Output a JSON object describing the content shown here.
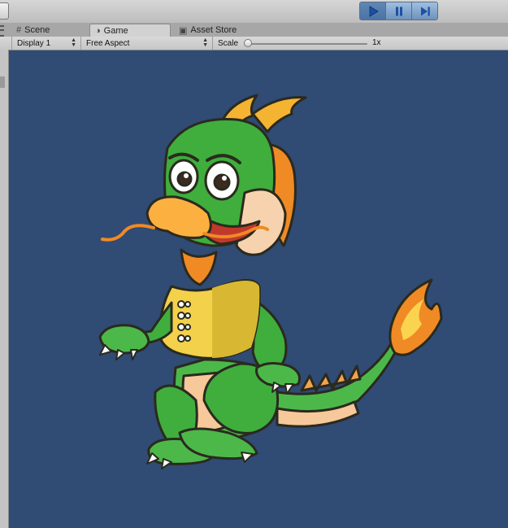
{
  "toolbar": {
    "play": {
      "icon": "play-icon",
      "active": true
    },
    "pause": {
      "icon": "pause-icon"
    },
    "step": {
      "icon": "step-icon"
    }
  },
  "tabs": [
    {
      "label": "Scene",
      "icon": "grid-icon"
    },
    {
      "label": "Game",
      "icon": "game-icon"
    },
    {
      "label": "Asset Store",
      "icon": "store-icon"
    }
  ],
  "game_view": {
    "display": "Display 1",
    "aspect": "Free Aspect",
    "scale_label": "Scale",
    "scale_value": "1x",
    "scale_slider_level": 0.0
  },
  "colors": {
    "canvas_bg": "#304b74",
    "play_active": "#4a74a6",
    "dragon_green": "#3fae3d",
    "vest_yellow": "#f4d14a",
    "fire_orange": "#f08a24"
  },
  "canvas": {
    "sprite": "green-dragon-character"
  }
}
